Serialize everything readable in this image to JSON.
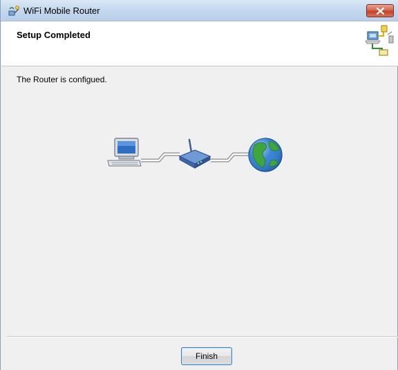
{
  "window": {
    "title": "WiFi Mobile Router",
    "icon": "router-wizard-icon",
    "close_icon": "close-icon"
  },
  "header": {
    "title": "Setup Completed",
    "icon": "network-setup-icon"
  },
  "content": {
    "message": "The Router is configued.",
    "diagram_icons": [
      "computer-icon",
      "wireless-router-icon",
      "globe-icon"
    ]
  },
  "footer": {
    "finish_label": "Finish"
  },
  "colors": {
    "title_bar": "#c6d9ef",
    "close_button": "#c4422a",
    "dialog_bg": "#f0f0f0",
    "header_bg": "#ffffff",
    "button_border": "#3c7fb1"
  }
}
